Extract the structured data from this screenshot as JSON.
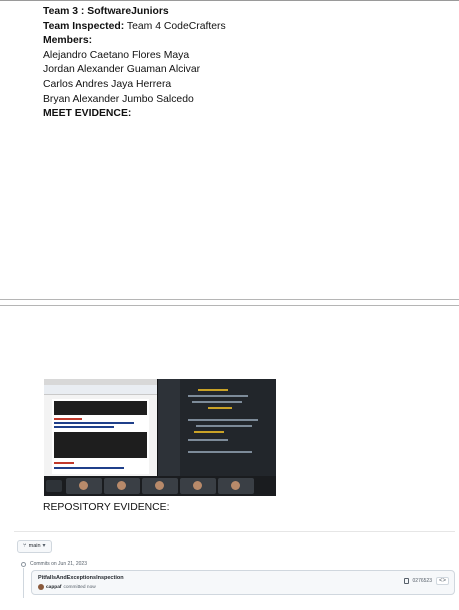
{
  "team": {
    "team_label": "Team 3 : SoftwareJuniors",
    "inspected_label": "Team Inspected:",
    "inspected_value": " Team 4 CodeCrafters",
    "members_label": "Members:",
    "members": [
      "Alejandro Caetano Flores Maya",
      "Jordan Alexander Guaman Alcivar",
      "Carlos Andres Jaya Herrera",
      "Bryan Alexander Jumbo Salcedo"
    ],
    "meet_heading": "MEET EVIDENCE:"
  },
  "repository": {
    "heading": "REPOSITORY EVIDENCE:",
    "branch": "main",
    "commits_date": "Commits on Jun 21, 2023",
    "commit_message": "PitfallsAndExceptionsInspection",
    "commit_author": "cappaf",
    "commit_action": "committed now",
    "commit_sha": "0276523"
  },
  "colors": {
    "text": "#111111",
    "page_break": "#b5b5b5",
    "github_border": "#d0d7de"
  }
}
